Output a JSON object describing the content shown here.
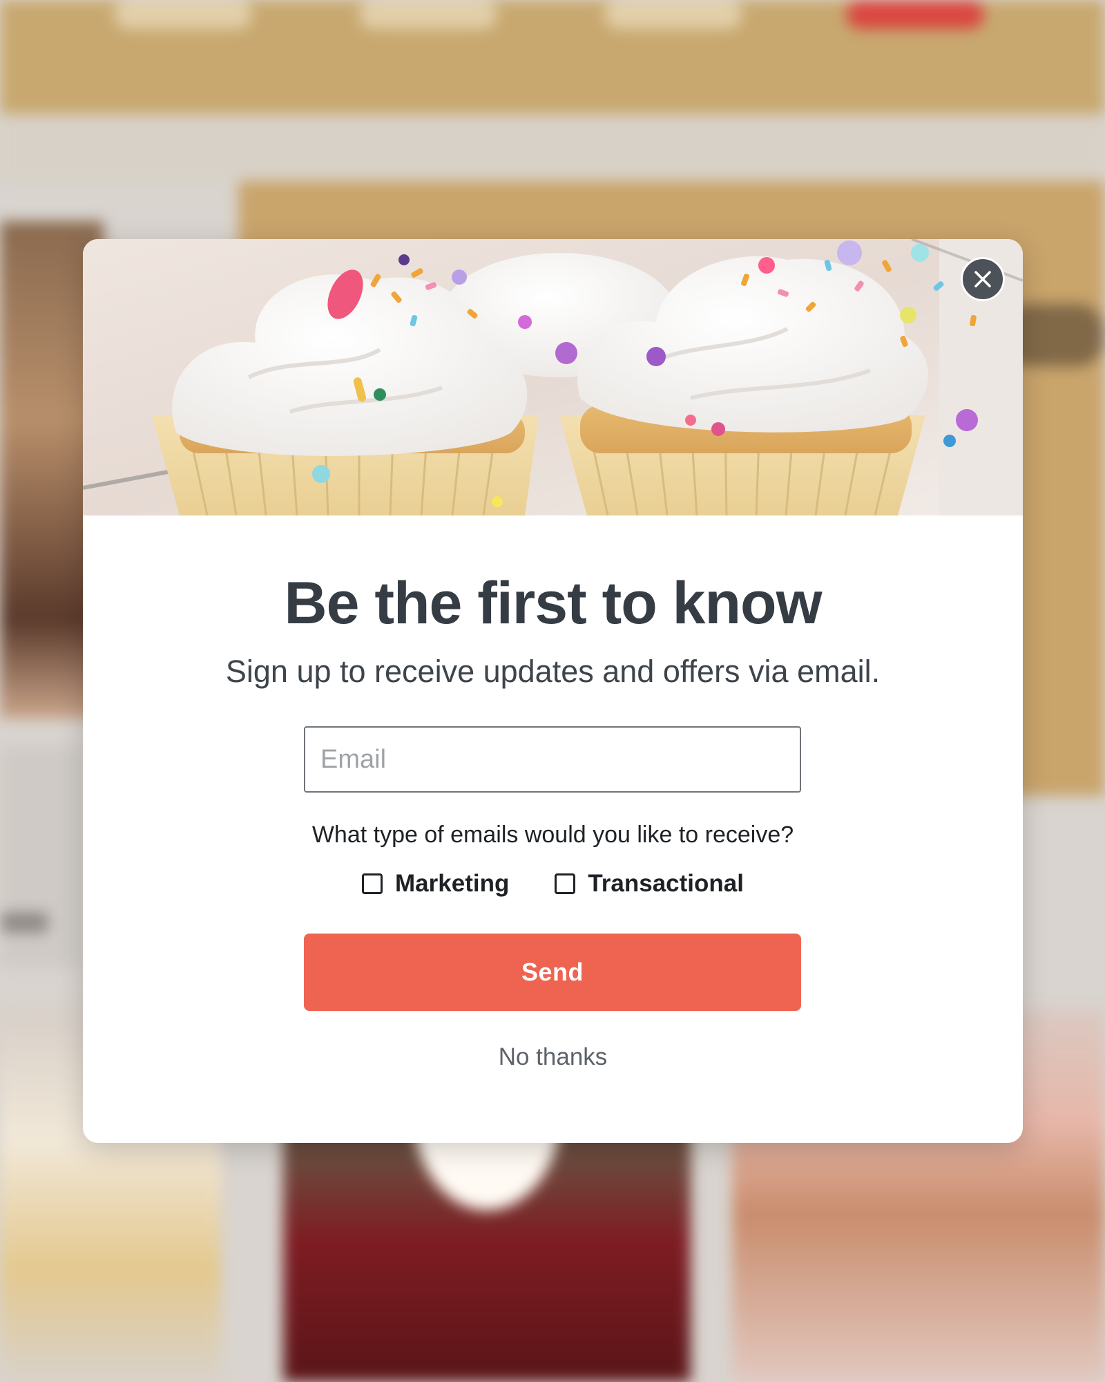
{
  "colors": {
    "accent": "#ee6451",
    "title_text": "#353c44",
    "close_button_bg": "#4d5258"
  },
  "modal": {
    "close_icon": "close-icon",
    "image": "cupcakes-with-sprinkles",
    "title": "Be the first to know",
    "subtitle": "Sign up to receive updates and offers via email.",
    "email_placeholder": "Email",
    "email_value": "",
    "question": "What type of emails would you like to receive?",
    "options": [
      {
        "label": "Marketing",
        "checked": false
      },
      {
        "label": "Transactional",
        "checked": false
      }
    ],
    "send_label": "Send",
    "dismiss_label": "No thanks"
  }
}
